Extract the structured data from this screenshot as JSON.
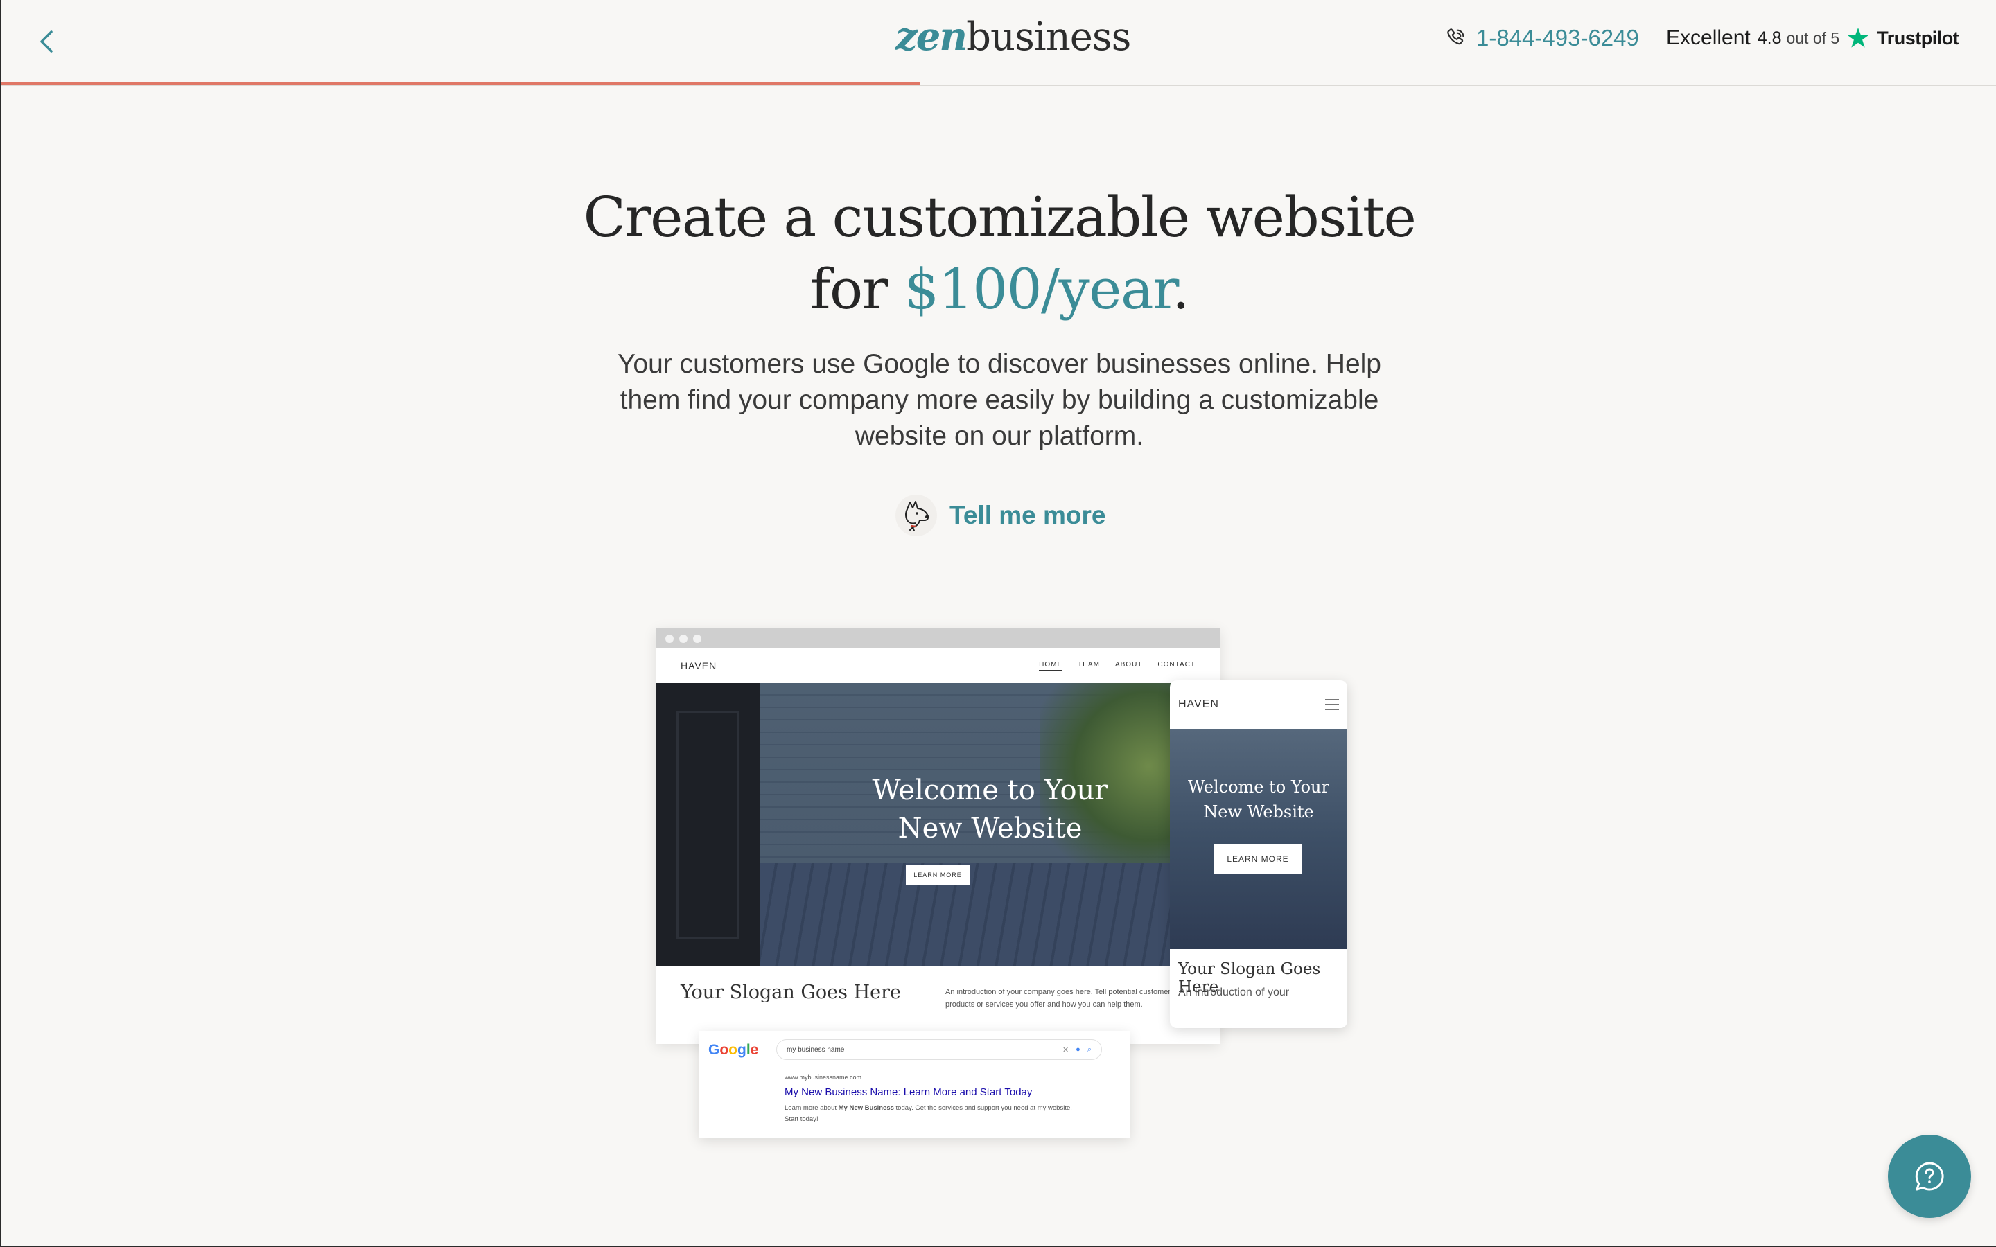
{
  "header": {
    "logo_prefix": "zen",
    "logo_suffix": "business",
    "phone": "1-844-493-6249",
    "rating_word": "Excellent",
    "rating_score": "4.8",
    "rating_scale": "out of 5",
    "trustpilot": "Trustpilot",
    "progress": 0.46,
    "accent_color": "#3b8c97",
    "progress_color": "#e07766"
  },
  "hero": {
    "headline_line1": "Create a customizable website",
    "headline_for": "for",
    "headline_price": "$100/year",
    "headline_period": ".",
    "subtext": "Your customers use Google to discover businesses online. Help them find your company more easily by building a customizable website on our platform.",
    "tell_me_more": "Tell me more"
  },
  "illustration": {
    "desktop": {
      "brand": "HAVEN",
      "nav": [
        "HOME",
        "TEAM",
        "ABOUT",
        "CONTACT"
      ],
      "hero_line1": "Welcome to Your",
      "hero_line2": "New Website",
      "button": "LEARN MORE",
      "slogan": "Your Slogan Goes Here",
      "intro": "An introduction of your company goes here. Tell potential customers about the products or services you offer and how you can help them."
    },
    "mobile": {
      "brand": "HAVEN",
      "hero_line1": "Welcome to Your",
      "hero_line2": "New Website",
      "button": "LEARN MORE",
      "slogan": "Your Slogan Goes Here",
      "intro": "An introduction of your"
    },
    "google": {
      "logo": "Google",
      "query": "my business name",
      "url": "www.mybusinessname.com",
      "title": "My New Business Name: Learn More and Start Today",
      "desc_pre": "Learn more about ",
      "desc_bold": "My New Business",
      "desc_post": " today. Get the services and support you need at my website. Start today!"
    }
  },
  "chat": {
    "icon": "help-chat-icon"
  }
}
